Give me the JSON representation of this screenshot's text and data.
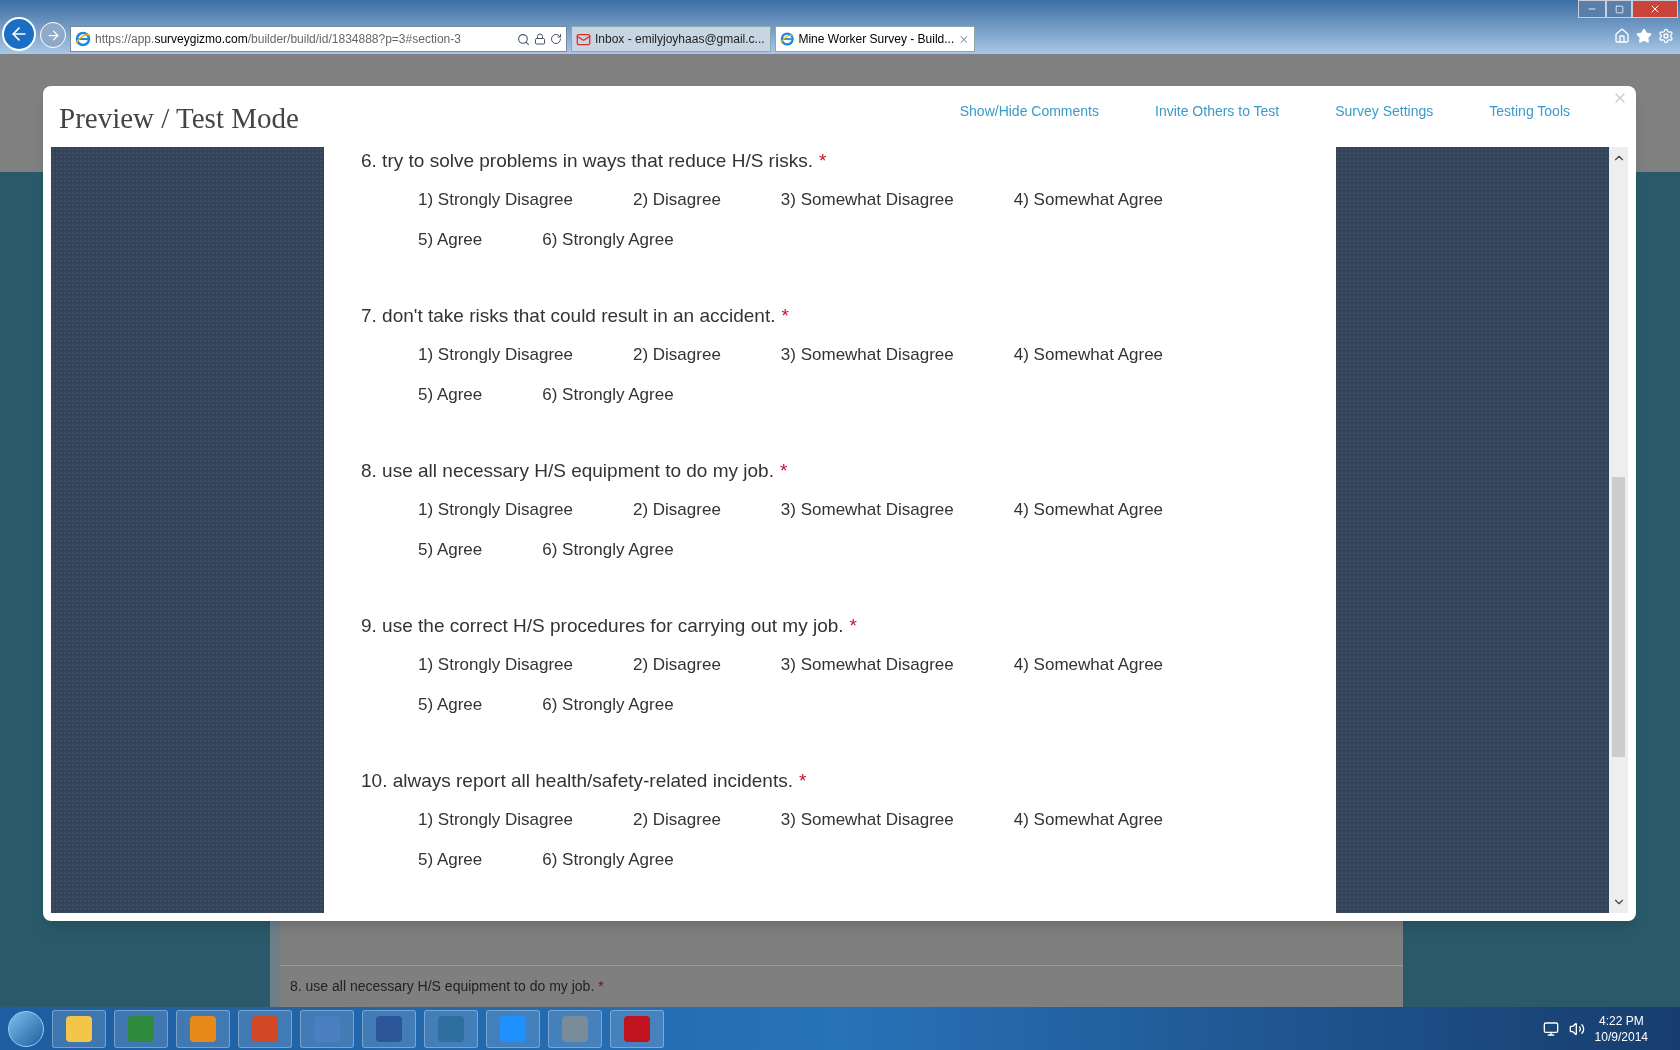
{
  "browser": {
    "url_prefix": "https://app.",
    "url_domain": "surveygizmo.com",
    "url_path": "/builder/build/id/1834888?p=3#section-3",
    "tabs": [
      {
        "title": "Inbox - emilyjoyhaas@gmail.c...",
        "kind": "mail",
        "selected": false
      },
      {
        "title": "Mine Worker Survey - Build...",
        "kind": "ie",
        "selected": true
      }
    ]
  },
  "modal": {
    "title": "Preview / Test Mode",
    "links": [
      "Show/Hide Comments",
      "Invite Others to Test",
      "Survey Settings",
      "Testing Tools"
    ],
    "questions": [
      {
        "text": "6. try to solve problems in ways that reduce H/S risks.",
        "required": true,
        "options": [
          "1) Strongly Disagree",
          "2) Disagree",
          "3) Somewhat Disagree",
          "4) Somewhat Agree",
          "5) Agree",
          "6) Strongly Agree"
        ]
      },
      {
        "text": "7. don't take risks that could result in an accident.",
        "required": true,
        "options": [
          "1) Strongly Disagree",
          "2) Disagree",
          "3) Somewhat Disagree",
          "4) Somewhat Agree",
          "5) Agree",
          "6) Strongly Agree"
        ]
      },
      {
        "text": "8. use all necessary H/S equipment to do my job.",
        "required": true,
        "options": [
          "1) Strongly Disagree",
          "2) Disagree",
          "3) Somewhat Disagree",
          "4) Somewhat Agree",
          "5) Agree",
          "6) Strongly Agree"
        ]
      },
      {
        "text": "9. use the correct H/S procedures for carrying out my job.",
        "required": true,
        "options": [
          "1) Strongly Disagree",
          "2) Disagree",
          "3) Somewhat Disagree",
          "4) Somewhat Agree",
          "5) Agree",
          "6) Strongly Agree"
        ]
      },
      {
        "text": "10. always report all health/safety-related incidents.",
        "required": true,
        "options": [
          "1) Strongly Disagree",
          "2) Disagree",
          "3) Somewhat Disagree",
          "4) Somewhat Agree",
          "5) Agree",
          "6) Strongly Agree"
        ]
      }
    ],
    "required_mark": "*"
  },
  "background": {
    "question_text": "8. use all necessary H/S equipment to do my job.",
    "required": true
  },
  "taskbar": {
    "time": "4:22 PM",
    "date": "10/9/2014"
  }
}
